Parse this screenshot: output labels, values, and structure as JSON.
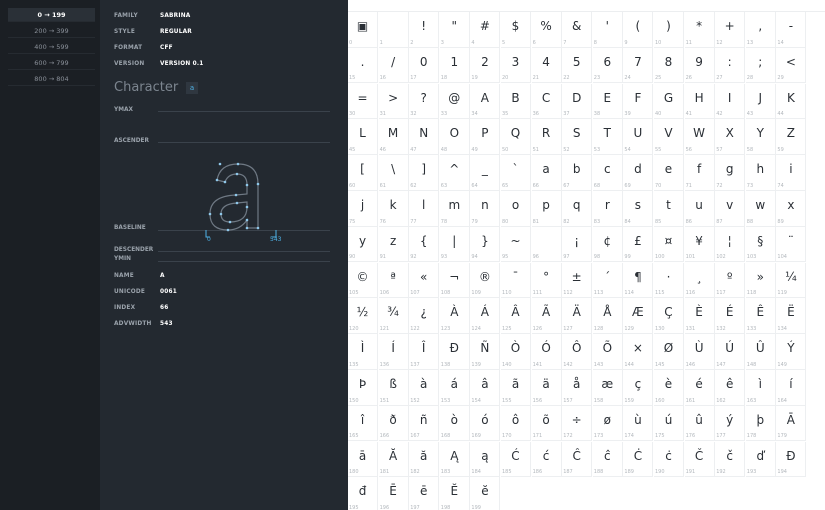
{
  "ranges": [
    "0 → 199",
    "200 → 399",
    "400 → 599",
    "600 → 799",
    "800 → 804"
  ],
  "active_range": 0,
  "font_info": {
    "family_label": "FAMILY",
    "family": "SABRINA",
    "style_label": "STYLE",
    "style": "REGULAR",
    "format_label": "FORMAT",
    "format": "CFF",
    "version_label": "VERSION",
    "version": "VERSION 0.1"
  },
  "character": {
    "title": "Character",
    "current": "a",
    "metrics": {
      "ymax": "YMAX",
      "ascender": "ASCENDER",
      "baseline": "BASELINE",
      "descender": "DESCENDER",
      "ymin": "YMIN"
    },
    "lsb": "0",
    "adv": "543",
    "name_label": "NAME",
    "name": "A",
    "unicode_label": "UNICODE",
    "unicode": "0061",
    "index_label": "INDEX",
    "index": "66",
    "advwidth_label": "ADVWIDTH",
    "advwidth": "543"
  },
  "accent_color": "#4fb3e8",
  "glyphs": [
    "▣",
    "",
    "!",
    "\"",
    "#",
    "$",
    "%",
    "&",
    "'",
    "(",
    ")",
    "*",
    "+",
    ",",
    "-",
    ".",
    "/",
    "0",
    "1",
    "2",
    "3",
    "4",
    "5",
    "6",
    "7",
    "8",
    "9",
    ":",
    ";",
    "<",
    "=",
    ">",
    "?",
    "@",
    "A",
    "B",
    "C",
    "D",
    "E",
    "F",
    "G",
    "H",
    "I",
    "J",
    "K",
    "L",
    "M",
    "N",
    "O",
    "P",
    "Q",
    "R",
    "S",
    "T",
    "U",
    "V",
    "W",
    "X",
    "Y",
    "Z",
    "[",
    "\\",
    "]",
    "^",
    "_",
    "`",
    "a",
    "b",
    "c",
    "d",
    "e",
    "f",
    "g",
    "h",
    "i",
    "j",
    "k",
    "l",
    "m",
    "n",
    "o",
    "p",
    "q",
    "r",
    "s",
    "t",
    "u",
    "v",
    "w",
    "x",
    "y",
    "z",
    "{",
    "|",
    "}",
    "~",
    "",
    "¡",
    "¢",
    "£",
    "¤",
    "¥",
    "¦",
    "§",
    "¨",
    "©",
    "ª",
    "«",
    "¬",
    "®",
    "¯",
    "°",
    "±",
    "´",
    "¶",
    "·",
    "¸",
    "º",
    "»",
    "¼",
    "½",
    "¾",
    "¿",
    "À",
    "Á",
    "Â",
    "Ã",
    "Ä",
    "Å",
    "Æ",
    "Ç",
    "È",
    "É",
    "Ê",
    "Ë",
    "Ì",
    "Í",
    "Î",
    "Ð",
    "Ñ",
    "Ò",
    "Ó",
    "Ô",
    "Õ",
    "×",
    "Ø",
    "Ù",
    "Ú",
    "Û",
    "Ý",
    "Þ",
    "ß",
    "à",
    "á",
    "â",
    "ã",
    "ä",
    "å",
    "æ",
    "ç",
    "è",
    "é",
    "ê",
    "ì",
    "í",
    "î",
    "ð",
    "ñ",
    "ò",
    "ó",
    "ô",
    "õ",
    "÷",
    "ø",
    "ù",
    "ú",
    "û",
    "ý",
    "þ",
    "Ā",
    "ā",
    "Ă",
    "ă",
    "Ą",
    "ą",
    "Ć",
    "ć",
    "Ĉ",
    "ĉ",
    "Ċ",
    "ċ",
    "Č",
    "č",
    "ď",
    "Đ",
    "đ",
    "Ē",
    "ē",
    "Ĕ",
    "ĕ"
  ]
}
